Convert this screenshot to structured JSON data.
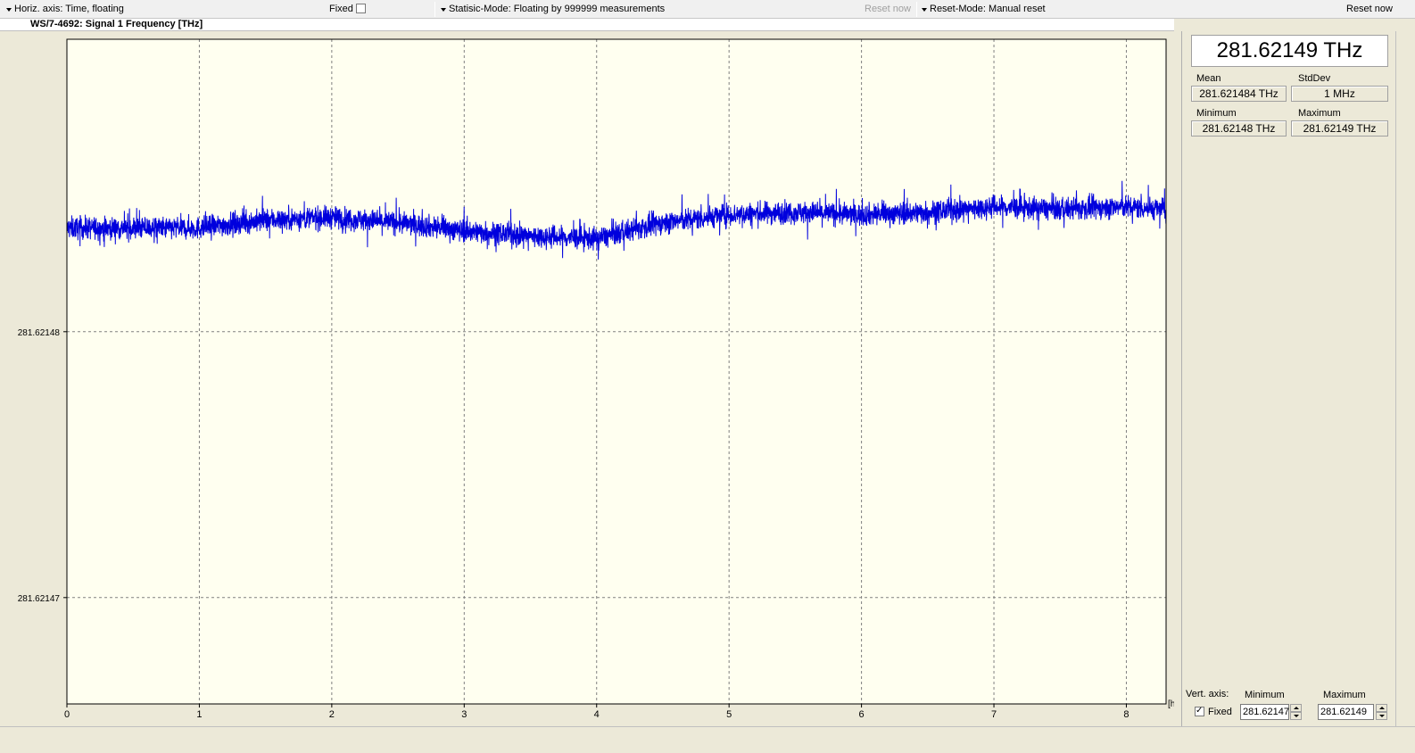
{
  "toolbar": {
    "horiz_axis_label": "Horiz. axis: Time,  floating",
    "fixed_label": "Fixed",
    "statistic_mode_label": "Statisic-Mode: Floating by 999999 measurements",
    "reset_now_left": "Reset now",
    "reset_mode_label": "Reset-Mode: Manual reset",
    "reset_now_right": "Reset now"
  },
  "chart_header": {
    "title": "WS/7-4692: Signal 1  Frequency  [THz]"
  },
  "chart_data": {
    "type": "line",
    "x_unit": "[h]",
    "ylim": [
      281.621466,
      281.621491
    ],
    "xlim": [
      0,
      8.3
    ],
    "ytick_labels": [
      "281.62148",
      "281.62147"
    ],
    "yticks": [
      281.62148,
      281.62147
    ],
    "xtick_labels": [
      "0",
      "1",
      "2",
      "3",
      "4",
      "5",
      "6",
      "7",
      "8"
    ],
    "xticks": [
      0,
      1,
      2,
      3,
      4,
      5,
      6,
      7,
      8
    ],
    "grid": true,
    "series": [
      {
        "color": "#0000DD",
        "trend_x": [
          0,
          0.5,
          1.0,
          1.5,
          2.0,
          2.5,
          3.0,
          3.5,
          4.0,
          4.5,
          5.0,
          5.5,
          6.0,
          6.5,
          7.0,
          7.5,
          8.0,
          8.3
        ],
        "trend_y": [
          281.6214839,
          281.6214839,
          281.6214839,
          281.6214842,
          281.6214843,
          281.6214841,
          281.6214838,
          281.6214836,
          281.6214835,
          281.6214841,
          281.6214844,
          281.6214845,
          281.6214844,
          281.6214845,
          281.6214847,
          281.6214846,
          281.6214847,
          281.6214846
        ],
        "noise_sd": 3e-07
      }
    ],
    "background_color": "#FFFFF0"
  },
  "stats": {
    "current_value": "281.62149 THz",
    "mean_label": "Mean",
    "mean_value": "281.621484 THz",
    "stddev_label": "StdDev",
    "stddev_value": "1 MHz",
    "minimum_label": "Minimum",
    "minimum_value": "281.62148 THz",
    "maximum_label": "Maximum",
    "maximum_value": "281.62149 THz"
  },
  "vert_axis": {
    "label": "Vert. axis:",
    "fixed_label": "Fixed",
    "fixed_checked": true,
    "minimum_label": "Minimum",
    "minimum_value": "281.62147",
    "maximum_label": "Maximum",
    "maximum_value": "281.62149"
  }
}
